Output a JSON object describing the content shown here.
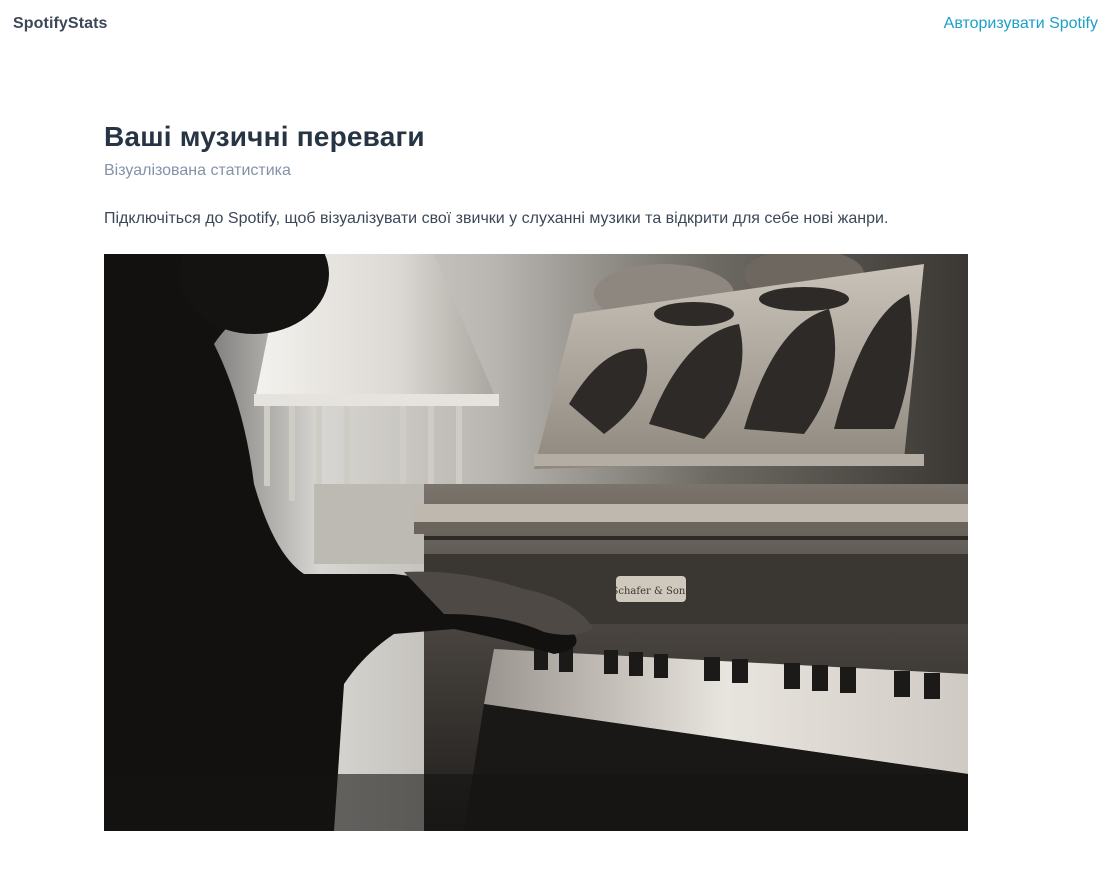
{
  "navbar": {
    "brand": "SpotifyStats",
    "auth_link": "Авторизувати Spotify"
  },
  "hero": {
    "title": "Ваші музичні переваги",
    "subtitle": "Візуалізована статистика",
    "lead": "Підключіться до Spotify, щоб візуалізувати свої звички у слуханні музики та відкрити для себе нові жанри.",
    "image": {
      "description": "black-and-white-photo-man-playing-upright-piano",
      "piano_brand_plate": "Schafer & Sons"
    }
  },
  "colors": {
    "brand_text": "#3c4858",
    "link": "#1c9fc8",
    "title": "#273444",
    "subtitle": "#8492a6"
  }
}
